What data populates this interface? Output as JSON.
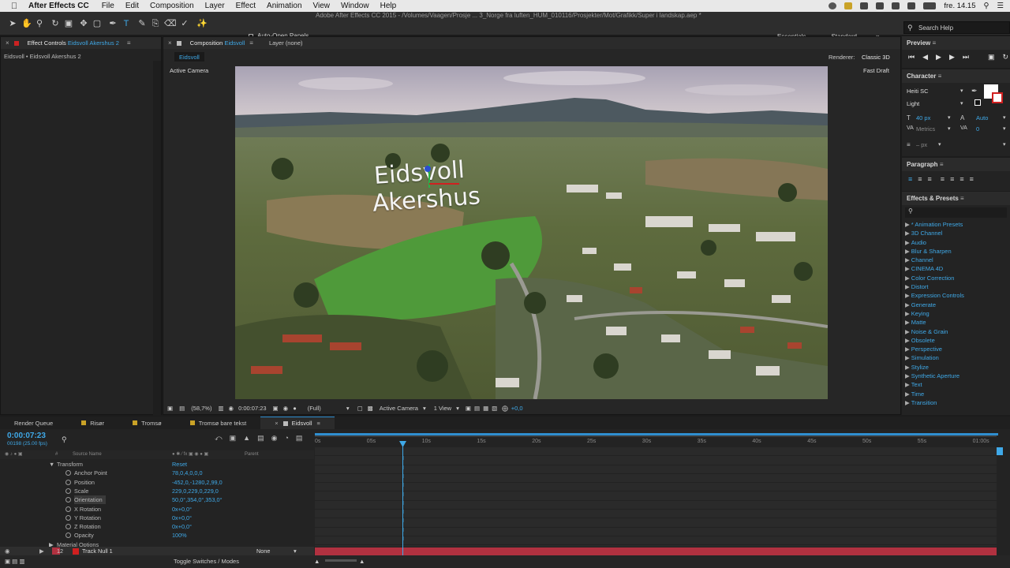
{
  "menubar": {
    "app": "After Effects CC",
    "items": [
      "File",
      "Edit",
      "Composition",
      "Layer",
      "Effect",
      "Animation",
      "View",
      "Window",
      "Help"
    ],
    "clock": "fre. 14.15"
  },
  "window_title": "Adobe After Effects CC 2015 - /Volumes/Vaagen/Prosje ... 3_Norge fra luften_HUM_010116/Prosjekter/Mot/Grafikk/Super i landskap.aep *",
  "toolbar": {
    "auto_open": "Auto-Open Panels",
    "workspaces": [
      "Essentials",
      "Standard"
    ],
    "search_placeholder": "Search Help"
  },
  "effect_controls": {
    "tab_label": "Effect Controls",
    "tab_layer": "Eidsvoll Akershus 2",
    "breadcrumb": "Eidsvoll • Eidsvoll Akershus 2"
  },
  "composition": {
    "tab_label": "Composition",
    "tab_comp": "Eidsvoll",
    "layer_tab": "Layer (none)",
    "comp_chip": "Eidsvoll",
    "renderer_label": "Renderer:",
    "renderer": "Classic 3D",
    "active_camera": "Active Camera",
    "fast_draft": "Fast Draft",
    "overlay_line1": "Eidsvoll",
    "overlay_line2": "Akershus",
    "footer": {
      "zoom": "(58,7%)",
      "time": "0:00:07:23",
      "resolution": "(Full)",
      "camera": "Active Camera",
      "views": "1 View",
      "exposure": "+0,0"
    }
  },
  "preview": {
    "title": "Preview"
  },
  "character": {
    "title": "Character",
    "font": "Heiti SC",
    "style": "Light",
    "size": "40 px",
    "leading": "Auto",
    "kerning": "Metrics",
    "tracking": "0",
    "stroke": "– px"
  },
  "paragraph": {
    "title": "Paragraph"
  },
  "effects_presets": {
    "title": "Effects & Presets",
    "items": [
      "* Animation Presets",
      "3D Channel",
      "Audio",
      "Blur & Sharpen",
      "Channel",
      "CINEMA 4D",
      "Color Correction",
      "Distort",
      "Expression Controls",
      "Generate",
      "Keying",
      "Matte",
      "Noise & Grain",
      "Obsolete",
      "Perspective",
      "Simulation",
      "Stylize",
      "Synthetic Aperture",
      "Text",
      "Time",
      "Transition"
    ]
  },
  "timeline": {
    "tabs": [
      "Render Queue",
      "Risør",
      "Tromsø",
      "Tromsø bare tekst",
      "Eidsvoll"
    ],
    "timecode": "0:00:07:23",
    "frames": "00198 (25.00 fps)",
    "col_num": "#",
    "col_source": "Source Name",
    "col_parent": "Parent",
    "ruler": [
      "0s",
      "05s",
      "10s",
      "15s",
      "20s",
      "25s",
      "30s",
      "35s",
      "40s",
      "45s",
      "50s",
      "55s",
      "01:00s"
    ],
    "transform": "Transform",
    "reset": "Reset",
    "props": [
      {
        "name": "Anchor Point",
        "value": "78,0,4,0,0,0"
      },
      {
        "name": "Position",
        "value": "-452,0,-1280,2,99,0"
      },
      {
        "name": "Scale",
        "value": "229,0,229,0,229,0"
      },
      {
        "name": "Orientation",
        "value": "50,0°,354,0°,353,0°"
      },
      {
        "name": "X Rotation",
        "value": "0x+0,0°"
      },
      {
        "name": "Y Rotation",
        "value": "0x+0,0°"
      },
      {
        "name": "Z Rotation",
        "value": "0x+0,0°"
      },
      {
        "name": "Opacity",
        "value": "100%"
      }
    ],
    "material_options": "Material Options",
    "layer": {
      "num": "12",
      "name": "Track Null 1",
      "parent": "None"
    },
    "toggle": "Toggle Switches / Modes"
  }
}
